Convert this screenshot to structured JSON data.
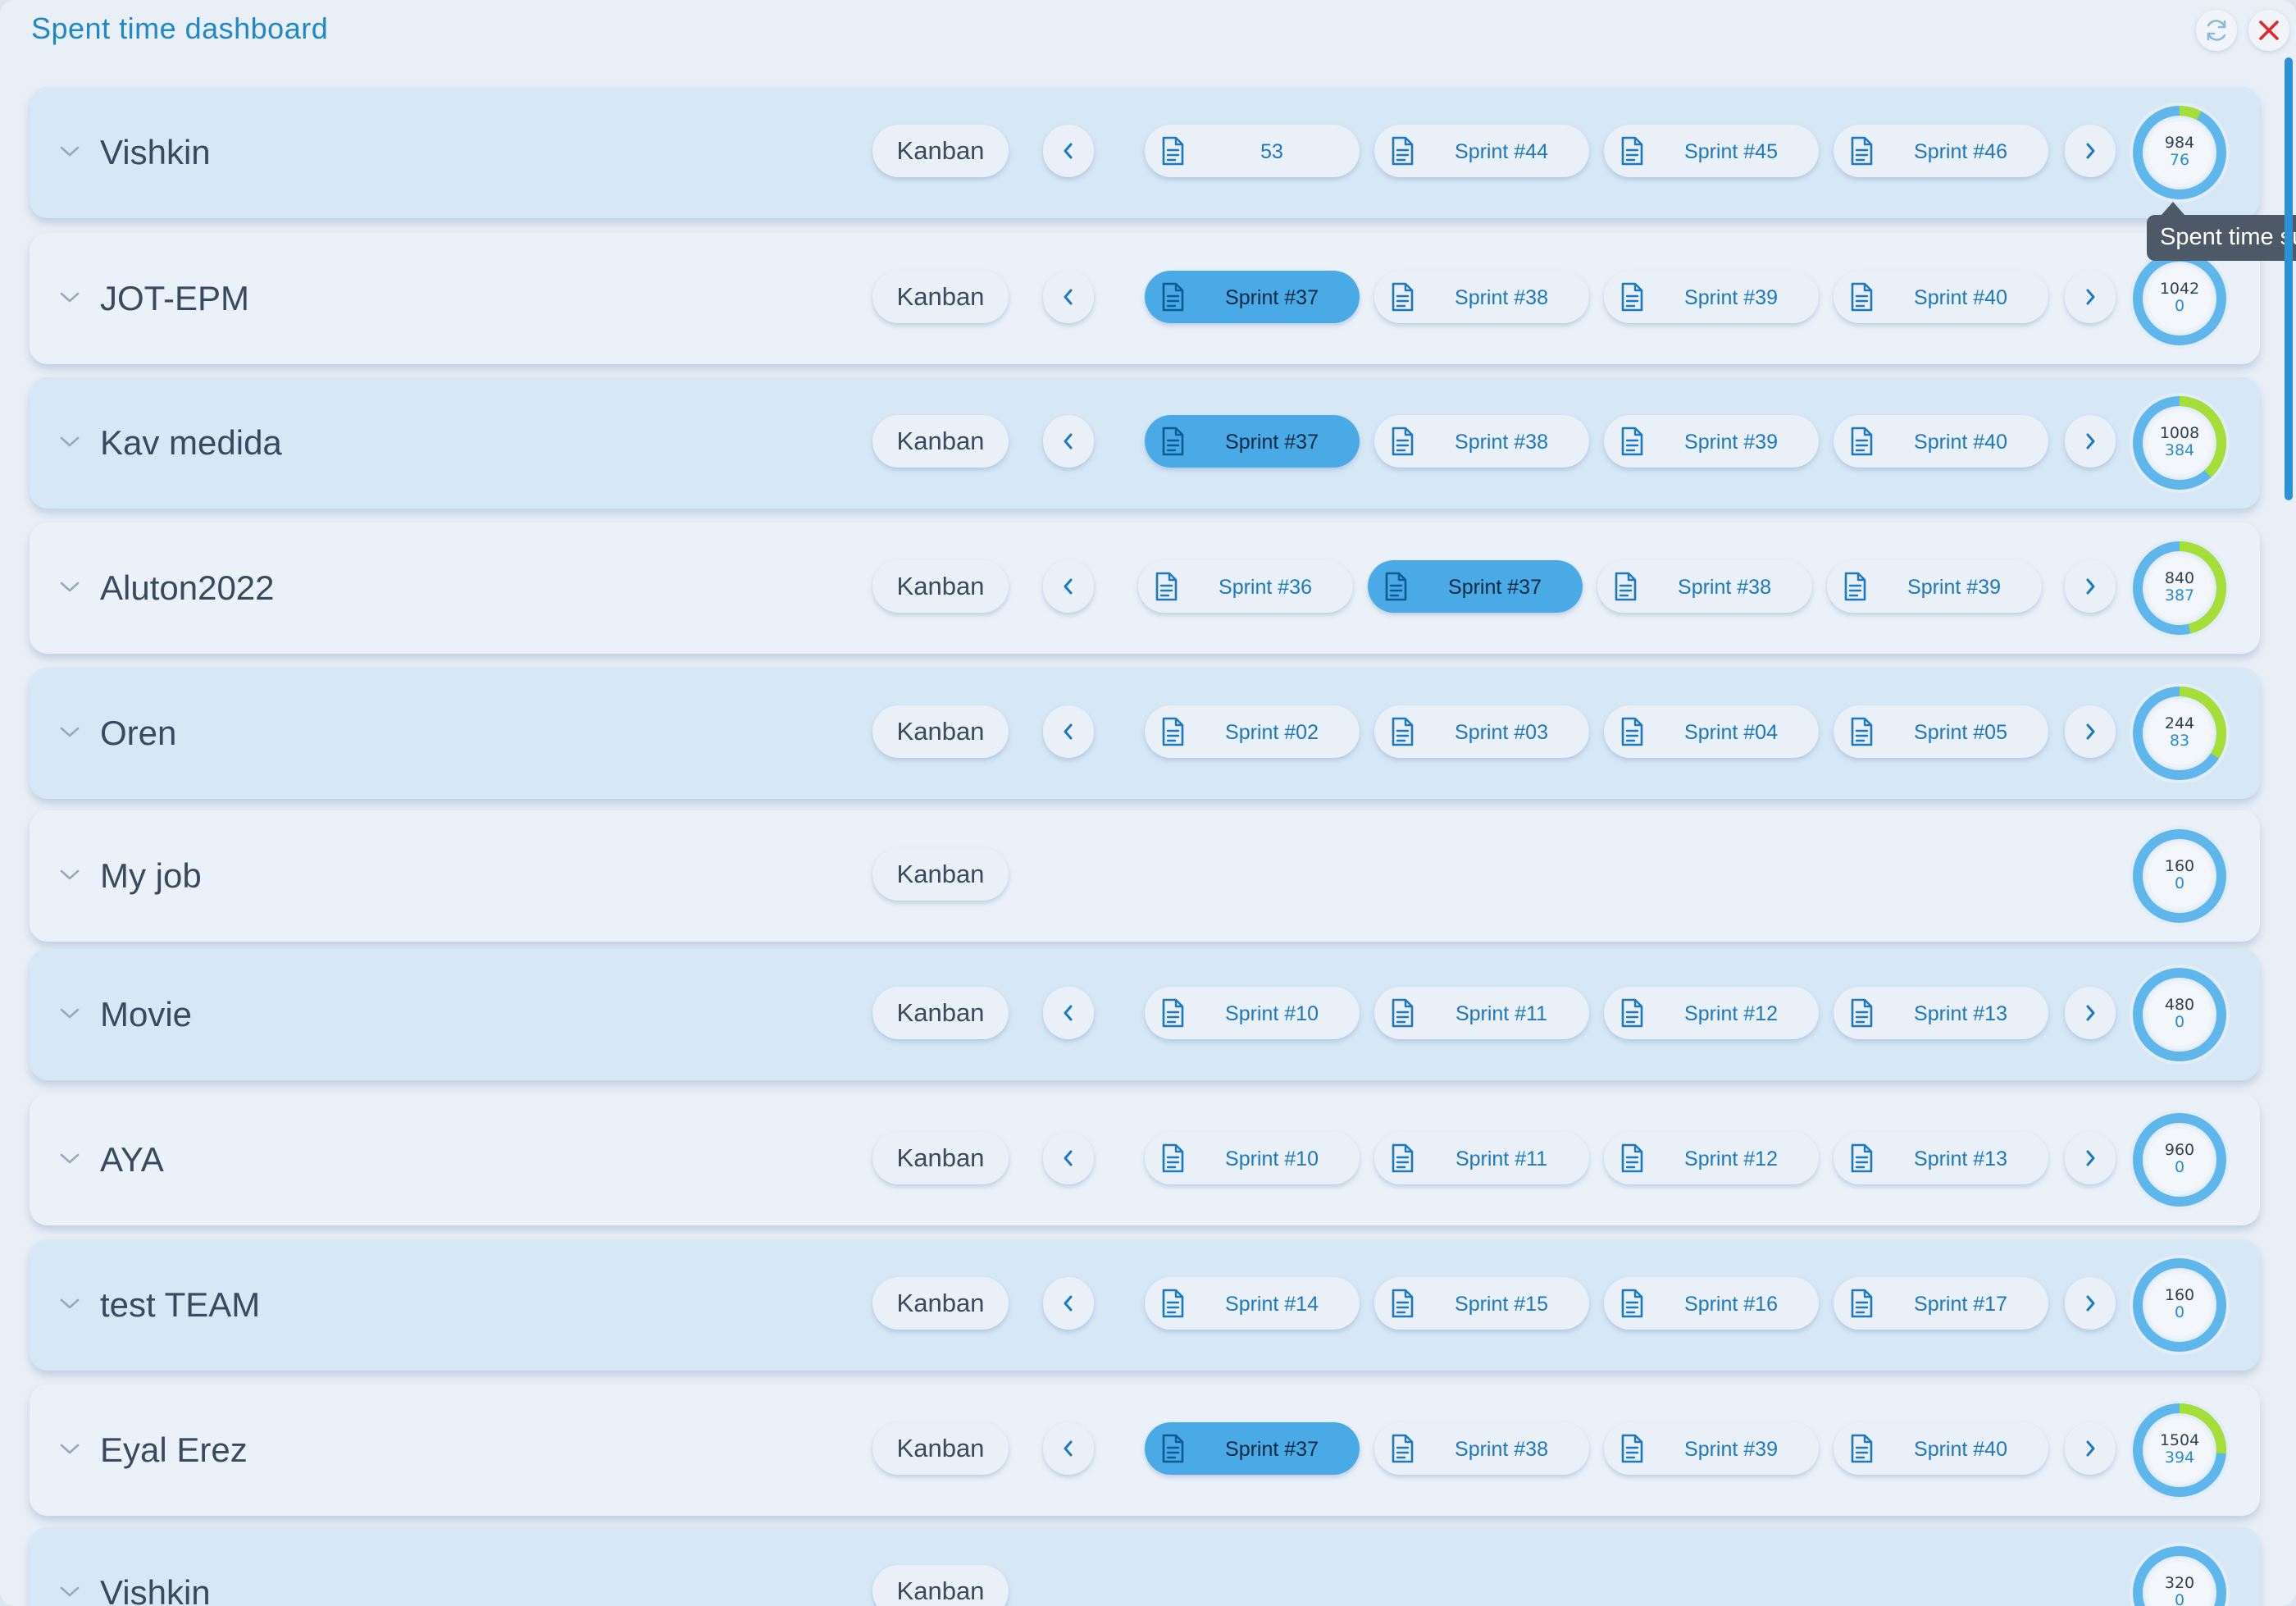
{
  "header": {
    "title": "Spent time dashboard"
  },
  "icons": {
    "refresh": "refresh-icon",
    "close": "close-icon",
    "collapse": "chevron-down-icon",
    "prev": "chevron-left-icon",
    "next": "chevron-right-icon",
    "sprint": "document-icon"
  },
  "colors": {
    "accent": "#1e88c9",
    "active_sprint": "#4aaae6",
    "gauge_progress": "#a6de38",
    "close": "#e0282e"
  },
  "tooltip": "Spent time su",
  "teams": [
    {
      "name": "Vishkin",
      "board": "Kanban",
      "sprints": [
        {
          "label": "53",
          "active": false
        },
        {
          "label": "Sprint #44",
          "active": false
        },
        {
          "label": "Sprint #45",
          "active": false
        },
        {
          "label": "Sprint #46",
          "active": false
        }
      ],
      "gauge": {
        "total": "984",
        "spent": "76",
        "fraction": 0.077
      }
    },
    {
      "name": "JOT-EPM",
      "board": "Kanban",
      "sprints": [
        {
          "label": "Sprint #37",
          "active": true
        },
        {
          "label": "Sprint #38",
          "active": false
        },
        {
          "label": "Sprint #39",
          "active": false
        },
        {
          "label": "Sprint #40",
          "active": false
        }
      ],
      "gauge": {
        "total": "1042",
        "spent": "0",
        "fraction": 0
      }
    },
    {
      "name": "Kav medida",
      "board": "Kanban",
      "sprints": [
        {
          "label": "Sprint #37",
          "active": true
        },
        {
          "label": "Sprint #38",
          "active": false
        },
        {
          "label": "Sprint #39",
          "active": false
        },
        {
          "label": "Sprint #40",
          "active": false
        }
      ],
      "gauge": {
        "total": "1008",
        "spent": "384",
        "fraction": 0.381
      }
    },
    {
      "name": "Aluton2022",
      "board": "Kanban",
      "sprints": [
        {
          "label": "Sprint #36",
          "active": false
        },
        {
          "label": "Sprint #37",
          "active": true
        },
        {
          "label": "Sprint #38",
          "active": false
        },
        {
          "label": "Sprint #39",
          "active": false
        }
      ],
      "gauge": {
        "total": "840",
        "spent": "387",
        "fraction": 0.461
      }
    },
    {
      "name": "Oren",
      "board": "Kanban",
      "sprints": [
        {
          "label": "Sprint #02",
          "active": false
        },
        {
          "label": "Sprint #03",
          "active": false
        },
        {
          "label": "Sprint #04",
          "active": false
        },
        {
          "label": "Sprint #05",
          "active": false
        }
      ],
      "gauge": {
        "total": "244",
        "spent": "83",
        "fraction": 0.34
      }
    },
    {
      "name": "My job",
      "board": "Kanban",
      "sprints": [],
      "gauge": {
        "total": "160",
        "spent": "0",
        "fraction": 0
      }
    },
    {
      "name": "Movie",
      "board": "Kanban",
      "sprints": [
        {
          "label": "Sprint #10",
          "active": false
        },
        {
          "label": "Sprint #11",
          "active": false
        },
        {
          "label": "Sprint #12",
          "active": false
        },
        {
          "label": "Sprint #13",
          "active": false
        }
      ],
      "gauge": {
        "total": "480",
        "spent": "0",
        "fraction": 0
      }
    },
    {
      "name": "AYA",
      "board": "Kanban",
      "sprints": [
        {
          "label": "Sprint #10",
          "active": false
        },
        {
          "label": "Sprint #11",
          "active": false
        },
        {
          "label": "Sprint #12",
          "active": false
        },
        {
          "label": "Sprint #13",
          "active": false
        }
      ],
      "gauge": {
        "total": "960",
        "spent": "0",
        "fraction": 0
      }
    },
    {
      "name": "test TEAM",
      "board": "Kanban",
      "sprints": [
        {
          "label": "Sprint #14",
          "active": false
        },
        {
          "label": "Sprint #15",
          "active": false
        },
        {
          "label": "Sprint #16",
          "active": false
        },
        {
          "label": "Sprint #17",
          "active": false
        }
      ],
      "gauge": {
        "total": "160",
        "spent": "0",
        "fraction": 0
      }
    },
    {
      "name": "Eyal Erez",
      "board": "Kanban",
      "sprints": [
        {
          "label": "Sprint #37",
          "active": true
        },
        {
          "label": "Sprint #38",
          "active": false
        },
        {
          "label": "Sprint #39",
          "active": false
        },
        {
          "label": "Sprint #40",
          "active": false
        }
      ],
      "gauge": {
        "total": "1504",
        "spent": "394",
        "fraction": 0.262
      }
    },
    {
      "name": "Vishkin",
      "board": "Kanban",
      "sprints": [],
      "gauge": {
        "total": "320",
        "spent": "0",
        "fraction": 0
      }
    }
  ]
}
